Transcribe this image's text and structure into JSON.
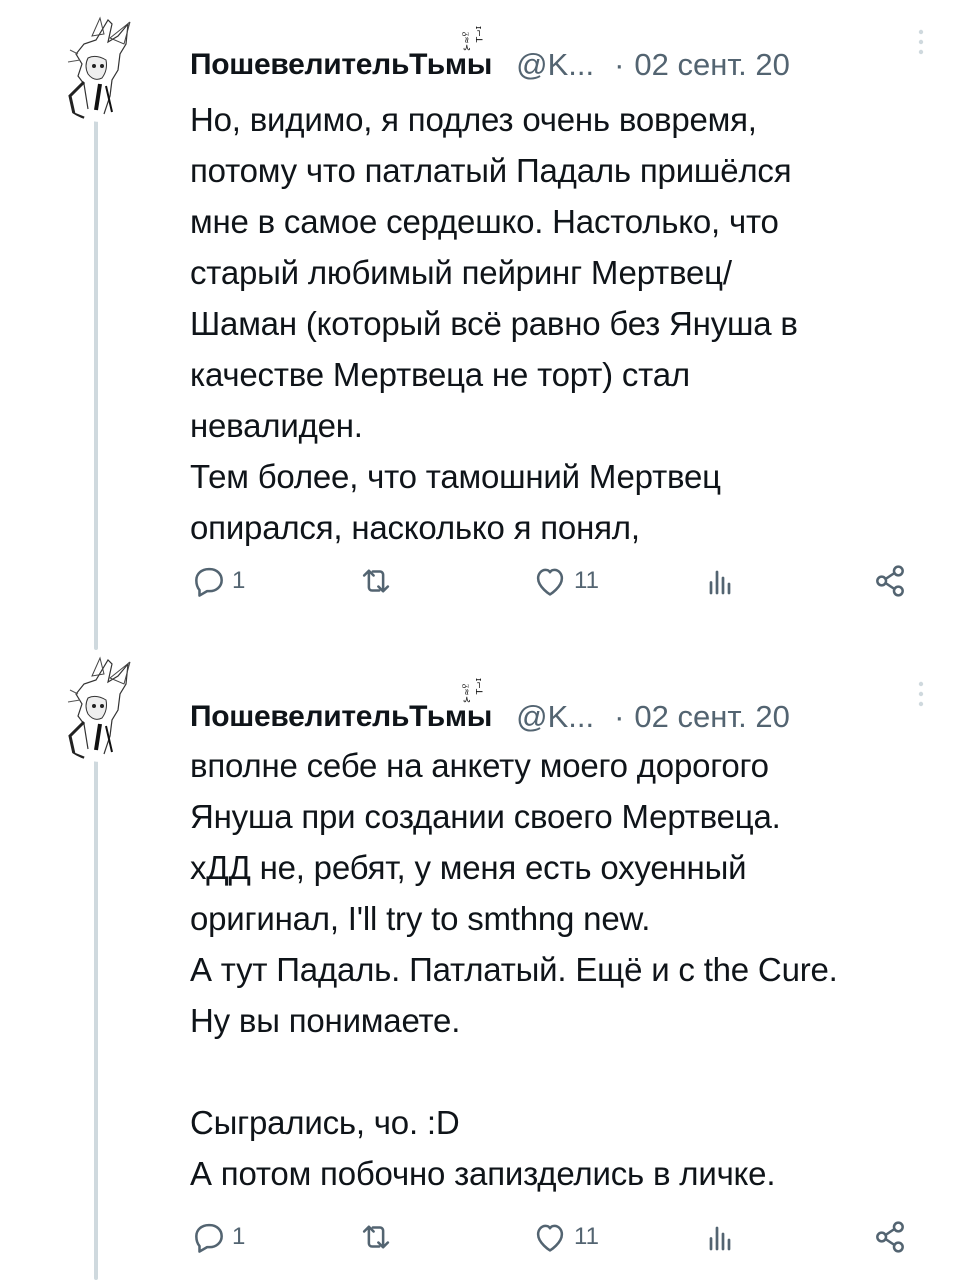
{
  "tweets": [
    {
      "author_name": "Пошевелитель",
      "author_name_tail": "Тьмы",
      "handle": "@K...",
      "separator": "·",
      "date": "02 сент. 20",
      "text": "Но, видимо, я подлез очень вовремя,\nпотому что патлатый Падаль пришёлся\nмне в самое сердешко. Настолько, что\nстарый любимый пейринг Мертвец/\nШаман (который всё равно без Януша в\nкачестве Мертвеца не торт) стал\nневалиден.\nТем более, что тамошний Мертвец\nопирался, насколько я понял,",
      "actions": {
        "reply_count": "1",
        "retweet_count": "",
        "like_count": "11",
        "views_count": ""
      }
    },
    {
      "author_name": "Пошевелитель",
      "author_name_tail": "Тьмы",
      "handle": "@K...",
      "separator": "·",
      "date": "02 сент. 20",
      "text": "вполне себе на анкету моего дорогого\nЯнуша при создании своего Мертвеца.\nхДД не, ребят, у меня есть охуенный\nоригинал, I'll try to smthng new.\nА тут Падаль. Патлатый. Ещё и с the Cure.\nНу вы понимаете.\n\nСыгрались, чо. :D\nА потом побочно запизделись в личке.",
      "actions": {
        "reply_count": "1",
        "retweet_count": "",
        "like_count": "11",
        "views_count": ""
      }
    }
  ],
  "icons": {
    "reply": "reply-icon",
    "retweet": "retweet-icon",
    "like": "heart-icon",
    "views": "views-icon",
    "share": "share-icon",
    "more": "more-vertical-icon"
  },
  "colors": {
    "text": "#0f1419",
    "secondary": "#536471",
    "thread_line": "#cfd9de"
  }
}
